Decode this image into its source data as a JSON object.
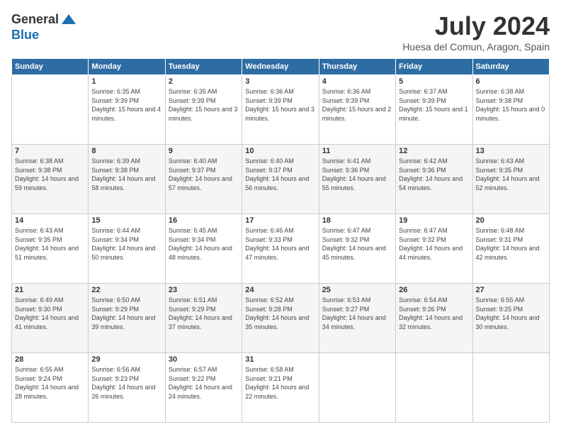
{
  "logo": {
    "general": "General",
    "blue": "Blue"
  },
  "header": {
    "month": "July 2024",
    "location": "Huesa del Comun, Aragon, Spain"
  },
  "weekdays": [
    "Sunday",
    "Monday",
    "Tuesday",
    "Wednesday",
    "Thursday",
    "Friday",
    "Saturday"
  ],
  "weeks": [
    [
      {
        "day": "",
        "sunrise": "",
        "sunset": "",
        "daylight": ""
      },
      {
        "day": "1",
        "sunrise": "Sunrise: 6:35 AM",
        "sunset": "Sunset: 9:39 PM",
        "daylight": "Daylight: 15 hours and 4 minutes."
      },
      {
        "day": "2",
        "sunrise": "Sunrise: 6:35 AM",
        "sunset": "Sunset: 9:39 PM",
        "daylight": "Daylight: 15 hours and 3 minutes."
      },
      {
        "day": "3",
        "sunrise": "Sunrise: 6:36 AM",
        "sunset": "Sunset: 9:39 PM",
        "daylight": "Daylight: 15 hours and 3 minutes."
      },
      {
        "day": "4",
        "sunrise": "Sunrise: 6:36 AM",
        "sunset": "Sunset: 9:39 PM",
        "daylight": "Daylight: 15 hours and 2 minutes."
      },
      {
        "day": "5",
        "sunrise": "Sunrise: 6:37 AM",
        "sunset": "Sunset: 9:39 PM",
        "daylight": "Daylight: 15 hours and 1 minute."
      },
      {
        "day": "6",
        "sunrise": "Sunrise: 6:38 AM",
        "sunset": "Sunset: 9:38 PM",
        "daylight": "Daylight: 15 hours and 0 minutes."
      }
    ],
    [
      {
        "day": "7",
        "sunrise": "Sunrise: 6:38 AM",
        "sunset": "Sunset: 9:38 PM",
        "daylight": "Daylight: 14 hours and 59 minutes."
      },
      {
        "day": "8",
        "sunrise": "Sunrise: 6:39 AM",
        "sunset": "Sunset: 9:38 PM",
        "daylight": "Daylight: 14 hours and 58 minutes."
      },
      {
        "day": "9",
        "sunrise": "Sunrise: 6:40 AM",
        "sunset": "Sunset: 9:37 PM",
        "daylight": "Daylight: 14 hours and 57 minutes."
      },
      {
        "day": "10",
        "sunrise": "Sunrise: 6:40 AM",
        "sunset": "Sunset: 9:37 PM",
        "daylight": "Daylight: 14 hours and 56 minutes."
      },
      {
        "day": "11",
        "sunrise": "Sunrise: 6:41 AM",
        "sunset": "Sunset: 9:36 PM",
        "daylight": "Daylight: 14 hours and 55 minutes."
      },
      {
        "day": "12",
        "sunrise": "Sunrise: 6:42 AM",
        "sunset": "Sunset: 9:36 PM",
        "daylight": "Daylight: 14 hours and 54 minutes."
      },
      {
        "day": "13",
        "sunrise": "Sunrise: 6:43 AM",
        "sunset": "Sunset: 9:35 PM",
        "daylight": "Daylight: 14 hours and 52 minutes."
      }
    ],
    [
      {
        "day": "14",
        "sunrise": "Sunrise: 6:43 AM",
        "sunset": "Sunset: 9:35 PM",
        "daylight": "Daylight: 14 hours and 51 minutes."
      },
      {
        "day": "15",
        "sunrise": "Sunrise: 6:44 AM",
        "sunset": "Sunset: 9:34 PM",
        "daylight": "Daylight: 14 hours and 50 minutes."
      },
      {
        "day": "16",
        "sunrise": "Sunrise: 6:45 AM",
        "sunset": "Sunset: 9:34 PM",
        "daylight": "Daylight: 14 hours and 48 minutes."
      },
      {
        "day": "17",
        "sunrise": "Sunrise: 6:46 AM",
        "sunset": "Sunset: 9:33 PM",
        "daylight": "Daylight: 14 hours and 47 minutes."
      },
      {
        "day": "18",
        "sunrise": "Sunrise: 6:47 AM",
        "sunset": "Sunset: 9:32 PM",
        "daylight": "Daylight: 14 hours and 45 minutes."
      },
      {
        "day": "19",
        "sunrise": "Sunrise: 6:47 AM",
        "sunset": "Sunset: 9:32 PM",
        "daylight": "Daylight: 14 hours and 44 minutes."
      },
      {
        "day": "20",
        "sunrise": "Sunrise: 6:48 AM",
        "sunset": "Sunset: 9:31 PM",
        "daylight": "Daylight: 14 hours and 42 minutes."
      }
    ],
    [
      {
        "day": "21",
        "sunrise": "Sunrise: 6:49 AM",
        "sunset": "Sunset: 9:30 PM",
        "daylight": "Daylight: 14 hours and 41 minutes."
      },
      {
        "day": "22",
        "sunrise": "Sunrise: 6:50 AM",
        "sunset": "Sunset: 9:29 PM",
        "daylight": "Daylight: 14 hours and 39 minutes."
      },
      {
        "day": "23",
        "sunrise": "Sunrise: 6:51 AM",
        "sunset": "Sunset: 9:29 PM",
        "daylight": "Daylight: 14 hours and 37 minutes."
      },
      {
        "day": "24",
        "sunrise": "Sunrise: 6:52 AM",
        "sunset": "Sunset: 9:28 PM",
        "daylight": "Daylight: 14 hours and 35 minutes."
      },
      {
        "day": "25",
        "sunrise": "Sunrise: 6:53 AM",
        "sunset": "Sunset: 9:27 PM",
        "daylight": "Daylight: 14 hours and 34 minutes."
      },
      {
        "day": "26",
        "sunrise": "Sunrise: 6:54 AM",
        "sunset": "Sunset: 9:26 PM",
        "daylight": "Daylight: 14 hours and 32 minutes."
      },
      {
        "day": "27",
        "sunrise": "Sunrise: 6:55 AM",
        "sunset": "Sunset: 9:25 PM",
        "daylight": "Daylight: 14 hours and 30 minutes."
      }
    ],
    [
      {
        "day": "28",
        "sunrise": "Sunrise: 6:55 AM",
        "sunset": "Sunset: 9:24 PM",
        "daylight": "Daylight: 14 hours and 28 minutes."
      },
      {
        "day": "29",
        "sunrise": "Sunrise: 6:56 AM",
        "sunset": "Sunset: 9:23 PM",
        "daylight": "Daylight: 14 hours and 26 minutes."
      },
      {
        "day": "30",
        "sunrise": "Sunrise: 6:57 AM",
        "sunset": "Sunset: 9:22 PM",
        "daylight": "Daylight: 14 hours and 24 minutes."
      },
      {
        "day": "31",
        "sunrise": "Sunrise: 6:58 AM",
        "sunset": "Sunset: 9:21 PM",
        "daylight": "Daylight: 14 hours and 22 minutes."
      },
      {
        "day": "",
        "sunrise": "",
        "sunset": "",
        "daylight": ""
      },
      {
        "day": "",
        "sunrise": "",
        "sunset": "",
        "daylight": ""
      },
      {
        "day": "",
        "sunrise": "",
        "sunset": "",
        "daylight": ""
      }
    ]
  ]
}
